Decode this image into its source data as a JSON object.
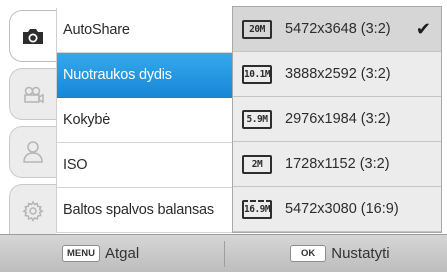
{
  "tabs": [
    {
      "icon": "camera-icon",
      "active": true
    },
    {
      "icon": "video-camera-icon",
      "active": false
    },
    {
      "icon": "user-icon",
      "active": false
    },
    {
      "icon": "gear-icon",
      "active": false
    }
  ],
  "menu": {
    "items": [
      {
        "label": "AutoShare"
      },
      {
        "label": "Nuotraukos dydis"
      },
      {
        "label": "Kokybė"
      },
      {
        "label": "ISO"
      },
      {
        "label": "Baltos spalvos balansas"
      }
    ],
    "selected_label": "Nuotraukos dydis"
  },
  "options": [
    {
      "badge": "20M",
      "label": "5472x3648 (3:2)",
      "checked": true
    },
    {
      "badge": "10.1M",
      "label": "3888x2592 (3:2)",
      "checked": false
    },
    {
      "badge": "5.9M",
      "label": "2976x1984 (3:2)",
      "checked": false
    },
    {
      "badge": "2M",
      "label": "1728x1152 (3:2)",
      "checked": false
    },
    {
      "badge": "16.9M",
      "label": "5472x3080 (16:9)",
      "checked": false
    }
  ],
  "bottom_bar": {
    "back_key": "MENU",
    "back_label": "Atgal",
    "confirm_key": "OK",
    "confirm_label": "Nustatyti"
  },
  "colors": {
    "selection": "#1e8fdc",
    "panel": "#e9e9e9",
    "bar": "#c8c8c8"
  }
}
